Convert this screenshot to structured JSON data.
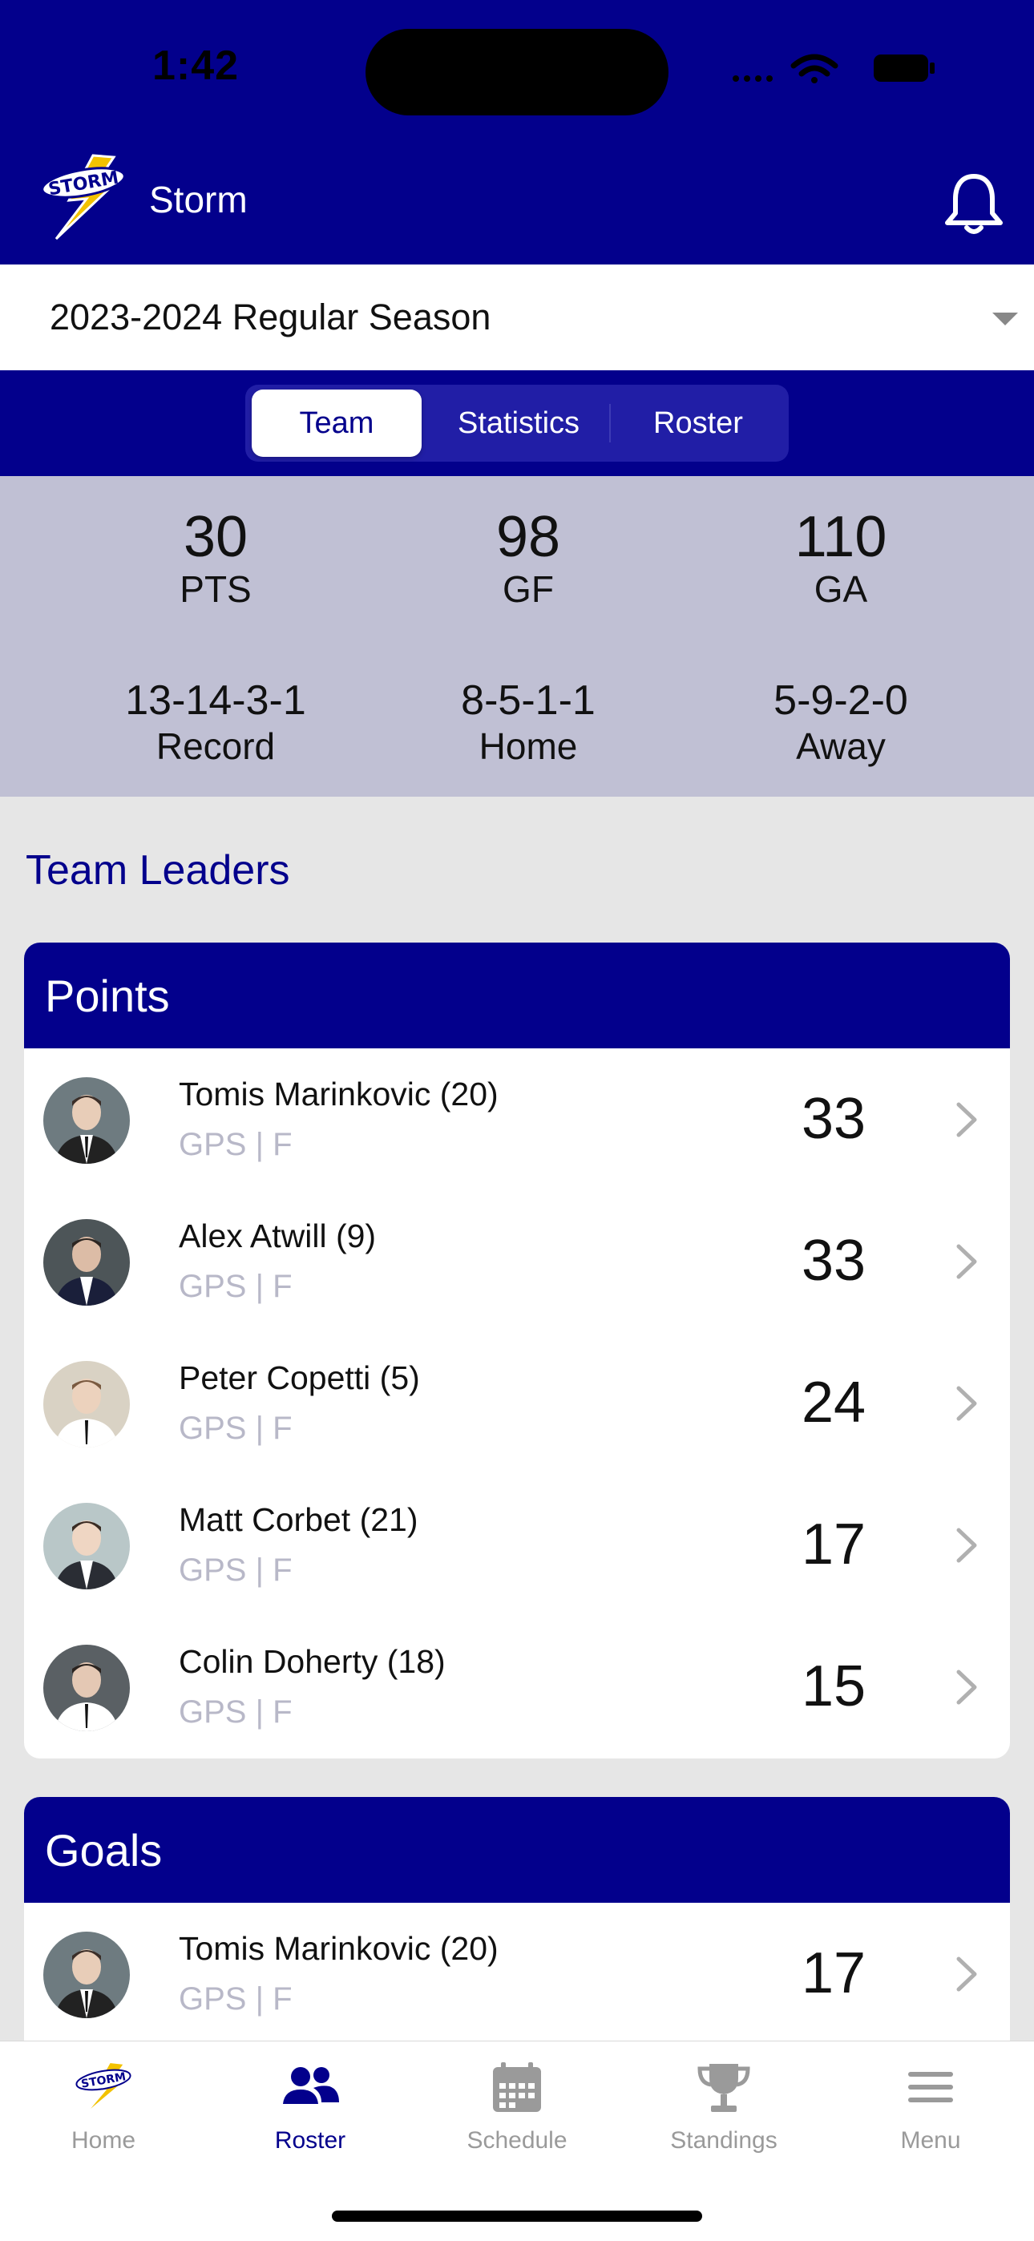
{
  "status_bar": {
    "time": "1:42"
  },
  "header": {
    "title": "Storm",
    "logo_text": "STORM"
  },
  "season": {
    "selected": "2023-2024 Regular Season"
  },
  "tabs": [
    {
      "label": "Team",
      "active": true
    },
    {
      "label": "Statistics",
      "active": false
    },
    {
      "label": "Roster",
      "active": false
    }
  ],
  "summary": {
    "top": [
      {
        "value": "30",
        "label": "PTS"
      },
      {
        "value": "98",
        "label": "GF"
      },
      {
        "value": "110",
        "label": "GA"
      }
    ],
    "bottom": [
      {
        "value": "13-14-3-1",
        "label": "Record"
      },
      {
        "value": "8-5-1-1",
        "label": "Home"
      },
      {
        "value": "5-9-2-0",
        "label": "Away"
      }
    ]
  },
  "leaders_title": "Team Leaders",
  "points_card": {
    "title": "Points",
    "players": [
      {
        "name": "Tomis Marinkovic (20)",
        "meta": "GPS | F",
        "value": "33"
      },
      {
        "name": "Alex Atwill (9)",
        "meta": "GPS | F",
        "value": "33"
      },
      {
        "name": "Peter Copetti (5)",
        "meta": "GPS | F",
        "value": "24"
      },
      {
        "name": "Matt Corbet (21)",
        "meta": "GPS | F",
        "value": "17"
      },
      {
        "name": "Colin Doherty (18)",
        "meta": "GPS | F",
        "value": "15"
      }
    ]
  },
  "goals_card": {
    "title": "Goals",
    "players": [
      {
        "name": "Tomis Marinkovic (20)",
        "meta": "GPS | F",
        "value": "17"
      }
    ]
  },
  "tabbar": [
    {
      "label": "Home",
      "icon": "storm-logo-icon",
      "active": false
    },
    {
      "label": "Roster",
      "icon": "people-icon",
      "active": true
    },
    {
      "label": "Schedule",
      "icon": "calendar-icon",
      "active": false
    },
    {
      "label": "Standings",
      "icon": "trophy-icon",
      "active": false
    },
    {
      "label": "Menu",
      "icon": "hamburger-icon",
      "active": false
    }
  ],
  "colors": {
    "brand": "#03008c",
    "summary_bg": "#c0c0d4",
    "page_bg": "#e6e6e6"
  }
}
